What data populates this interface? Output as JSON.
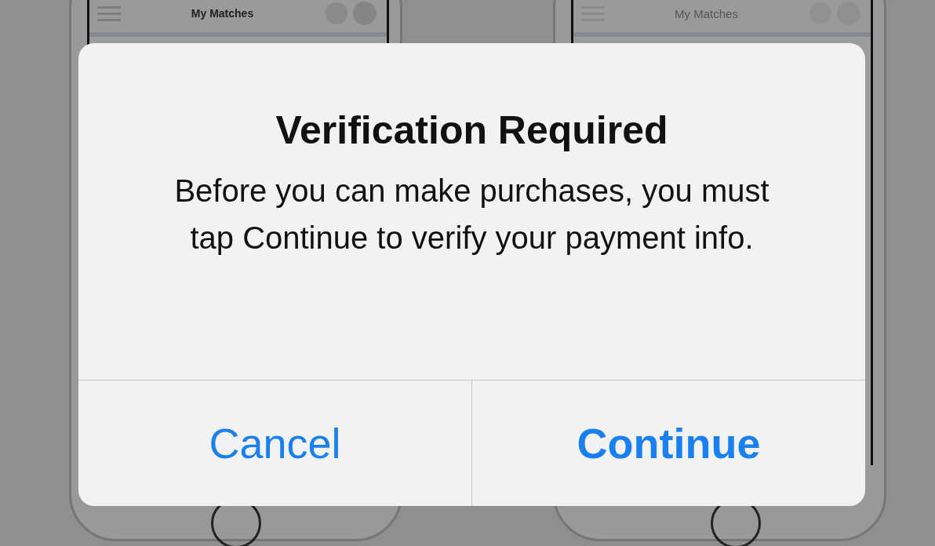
{
  "phones": [
    {
      "title": "My Matches"
    },
    {
      "title": "My Matches"
    }
  ],
  "dialog": {
    "title": "Verification Required",
    "message": "Before you can make purchases, you must tap Continue to verify your payment info.",
    "buttons": [
      {
        "label": "Cancel",
        "kind": "cancel"
      },
      {
        "label": "Continue",
        "kind": "preferred"
      }
    ]
  }
}
